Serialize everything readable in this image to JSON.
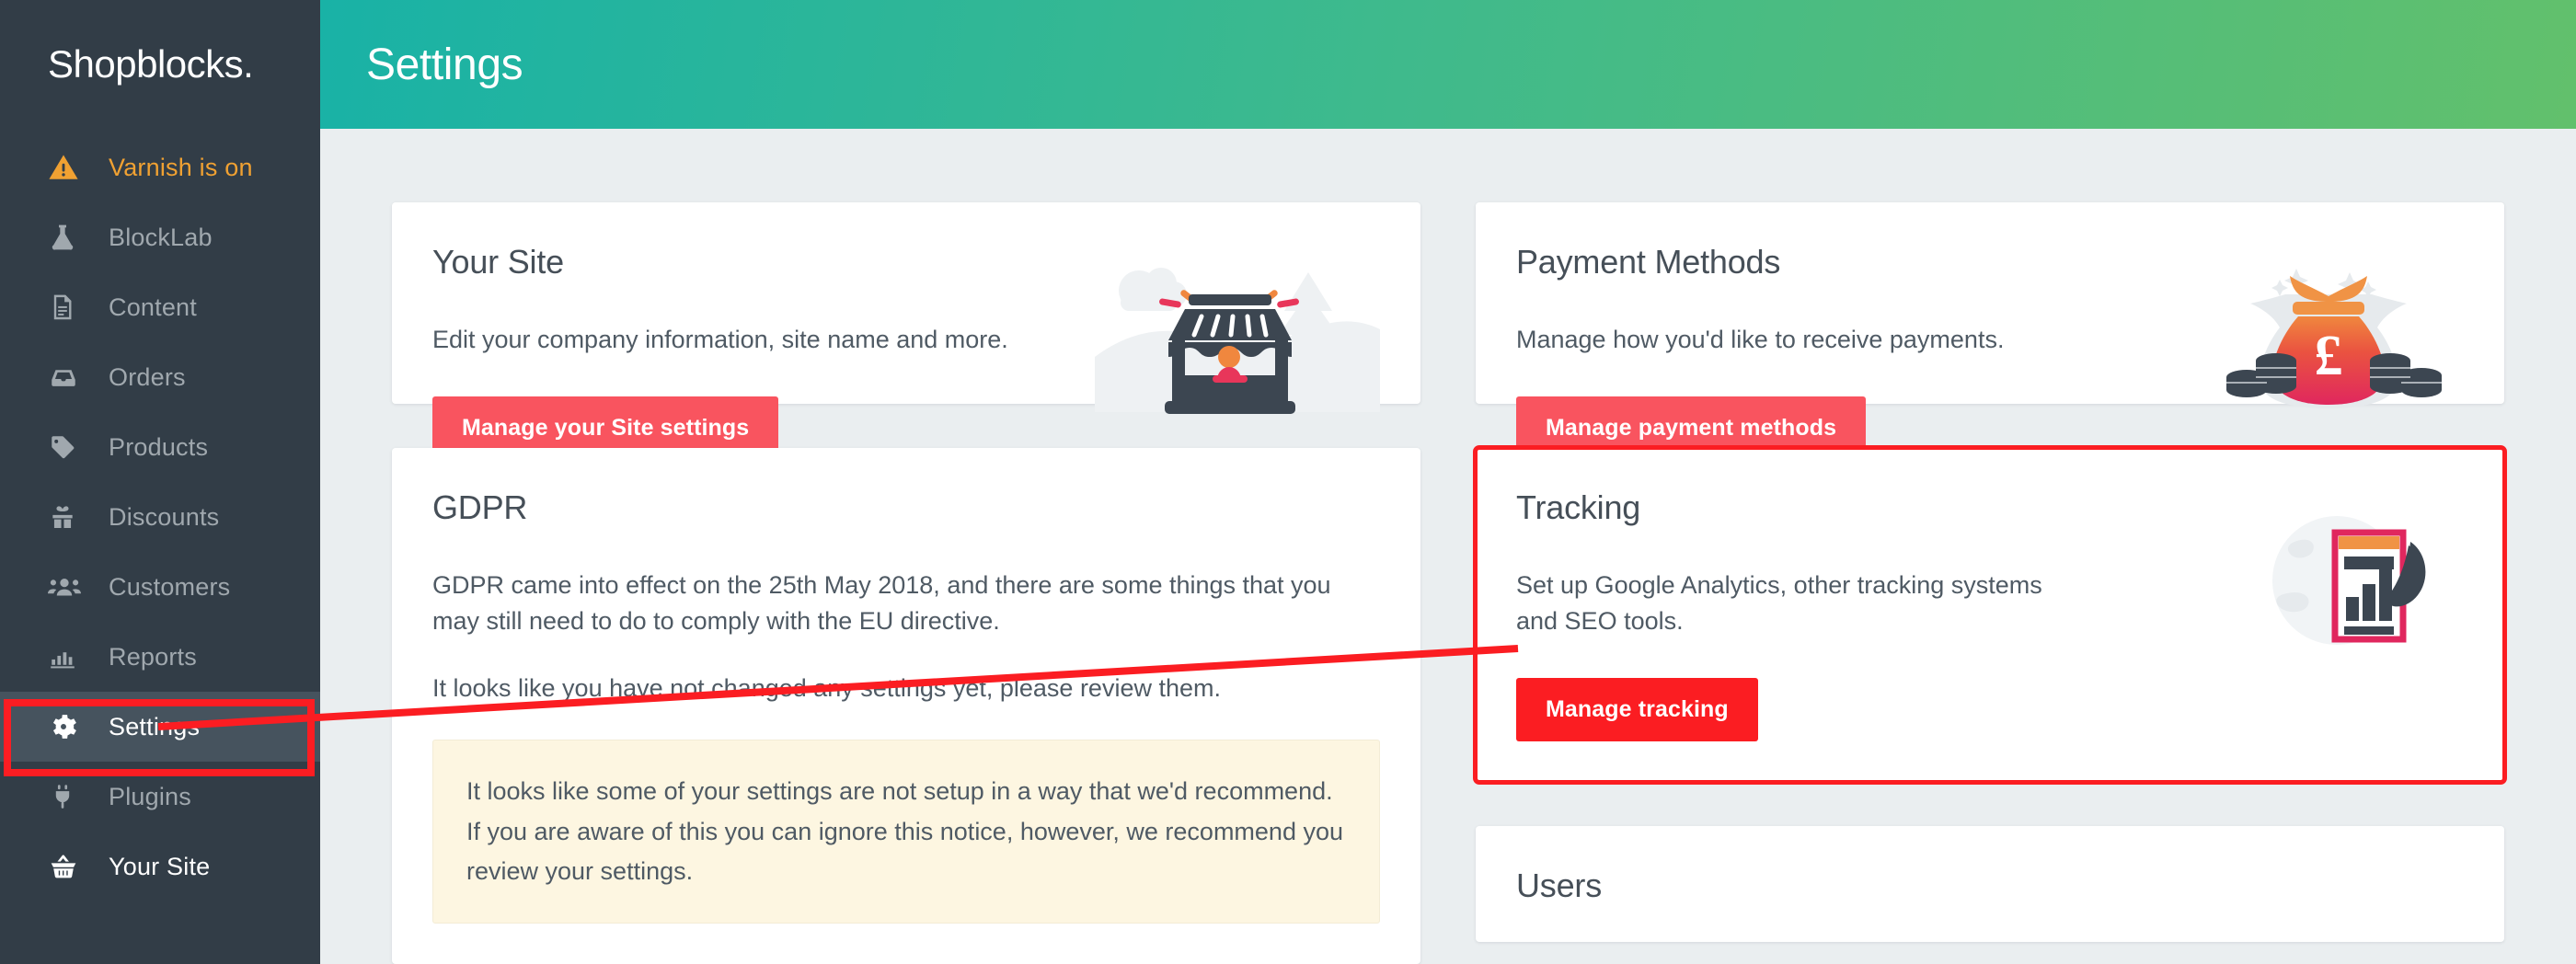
{
  "brand": {
    "name": "Shopblocks."
  },
  "header": {
    "title": "Settings"
  },
  "sidebar": {
    "items": [
      {
        "label": "Varnish is on",
        "icon": "warning-triangle-icon",
        "state": "warn"
      },
      {
        "label": "BlockLab",
        "icon": "flask-icon",
        "state": "normal"
      },
      {
        "label": "Content",
        "icon": "document-icon",
        "state": "normal"
      },
      {
        "label": "Orders",
        "icon": "inbox-icon",
        "state": "normal"
      },
      {
        "label": "Products",
        "icon": "tag-icon",
        "state": "normal"
      },
      {
        "label": "Discounts",
        "icon": "gift-icon",
        "state": "normal"
      },
      {
        "label": "Customers",
        "icon": "users-icon",
        "state": "normal"
      },
      {
        "label": "Reports",
        "icon": "bar-chart-icon",
        "state": "normal"
      },
      {
        "label": "Settings",
        "icon": "gear-icon",
        "state": "active"
      },
      {
        "label": "Plugins",
        "icon": "plug-icon",
        "state": "normal"
      },
      {
        "label": "Your Site",
        "icon": "basket-icon",
        "state": "bright"
      }
    ]
  },
  "cards": {
    "your_site": {
      "title": "Your Site",
      "description": "Edit your company information, site name and more.",
      "button": "Manage your Site settings",
      "art": "storefront-illustration"
    },
    "payment_methods": {
      "title": "Payment Methods",
      "description": "Manage how you'd like to receive payments.",
      "button": "Manage payment methods",
      "art": "money-bag-illustration"
    },
    "gdpr": {
      "title": "GDPR",
      "description": "GDPR came into effect on the 25th May 2018, and there are some things that you may still need to do to comply with the EU directive.",
      "description2": "It looks like you have not changed any settings yet, please review them.",
      "notice": "It looks like some of your settings are not setup in a way that we'd recommend. If you are aware of this you can ignore this notice, however, we recommend you review your settings."
    },
    "tracking": {
      "title": "Tracking",
      "description": "Set up Google Analytics, other tracking systems and SEO tools.",
      "button": "Manage tracking",
      "art": "analytics-rocket-illustration"
    },
    "users": {
      "title": "Users"
    }
  },
  "annotations": {
    "highlight_color": "#fb1d22",
    "targets": [
      "sidebar-item-settings",
      "card-tracking",
      "manage-tracking-button"
    ]
  },
  "colors": {
    "sidebar_bg": "#323d47",
    "header_gradient_start": "#19b2a6",
    "header_gradient_end": "#62c06c",
    "button_red": "#f9545f",
    "highlight_red": "#fb1d22",
    "warn_orange": "#f0a132",
    "page_bg": "#eaeef0",
    "notice_bg": "#fdf6e1"
  }
}
